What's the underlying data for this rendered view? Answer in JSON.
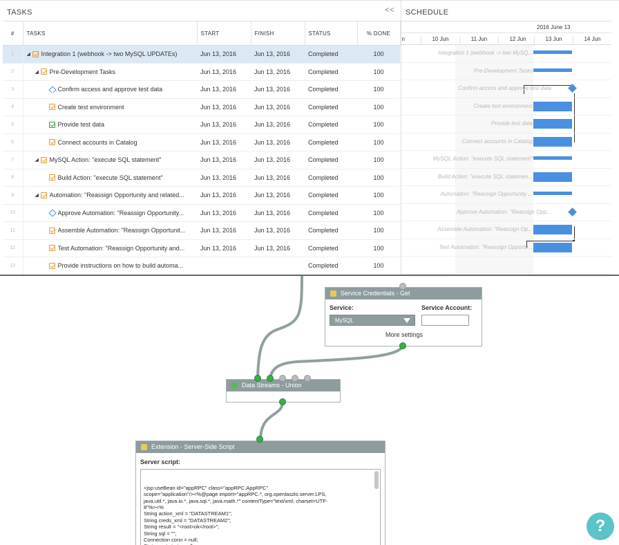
{
  "tasks_pane": {
    "title": "TASKS",
    "collapse_glyph": "<<",
    "columns": {
      "num": "#",
      "tasks": "TASKS",
      "start": "START",
      "finish": "FINISH",
      "status": "STATUS",
      "pct": "% DONE"
    },
    "rows": [
      {
        "num": "1",
        "indent": 0,
        "caret": "◢",
        "icon": "task-check",
        "name": "Integration 1 (webhook -> two MySQL UPDATEs)",
        "start": "Jun 13, 2016",
        "finish": "Jun 13, 2016",
        "status": "Completed",
        "pct": "100",
        "selected": true
      },
      {
        "num": "2",
        "indent": 1,
        "caret": "◢",
        "icon": "task-check",
        "name": "Pre-Development Tasks",
        "start": "Jun 13, 2016",
        "finish": "Jun 13, 2016",
        "status": "Completed",
        "pct": "100"
      },
      {
        "num": "3",
        "indent": 2,
        "caret": "",
        "icon": "milestone",
        "name": "Confirm access and approve test data",
        "start": "Jun 13, 2016",
        "finish": "Jun 13, 2016",
        "status": "Completed",
        "pct": "100"
      },
      {
        "num": "4",
        "indent": 2,
        "caret": "",
        "icon": "task-check",
        "name": "Create test environment",
        "start": "Jun 13, 2016",
        "finish": "Jun 13, 2016",
        "status": "Completed",
        "pct": "100"
      },
      {
        "num": "5",
        "indent": 2,
        "caret": "",
        "icon": "task-plus",
        "name": "Provide test data",
        "start": "Jun 13, 2016",
        "finish": "Jun 13, 2016",
        "status": "Completed",
        "pct": "100"
      },
      {
        "num": "6",
        "indent": 2,
        "caret": "",
        "icon": "task-check",
        "name": "Connect accounts in Catalog",
        "start": "Jun 13, 2016",
        "finish": "Jun 13, 2016",
        "status": "Completed",
        "pct": "100"
      },
      {
        "num": "7",
        "indent": 1,
        "caret": "◢",
        "icon": "task-check",
        "name": "MySQL Action: \"execute SQL statement\"",
        "start": "Jun 13, 2016",
        "finish": "Jun 13, 2016",
        "status": "Completed",
        "pct": "100"
      },
      {
        "num": "8",
        "indent": 2,
        "caret": "",
        "icon": "task-check",
        "name": "Build Action: \"execute SQL statement\"",
        "start": "Jun 13, 2016",
        "finish": "Jun 13, 2016",
        "status": "Completed",
        "pct": "100"
      },
      {
        "num": "9",
        "indent": 1,
        "caret": "◢",
        "icon": "task-check",
        "name": "Automation: \"Reassign Opportunity and related...",
        "start": "Jun 13, 2016",
        "finish": "Jun 13, 2016",
        "status": "Completed",
        "pct": "100"
      },
      {
        "num": "10",
        "indent": 2,
        "caret": "",
        "icon": "milestone",
        "name": "Approve Automation: \"Reassign Opportunity...",
        "start": "Jun 13, 2016",
        "finish": "Jun 13, 2016",
        "status": "Completed",
        "pct": "100"
      },
      {
        "num": "11",
        "indent": 2,
        "caret": "",
        "icon": "task-check",
        "name": "Assemble Automation: \"Reassign Opportunit...",
        "start": "Jun 13, 2016",
        "finish": "Jun 13, 2016",
        "status": "Completed",
        "pct": "100"
      },
      {
        "num": "12",
        "indent": 2,
        "caret": "",
        "icon": "task-check",
        "name": "Test Automation: \"Reassign Opportunity and...",
        "start": "Jun 13, 2016",
        "finish": "Jun 13, 2016",
        "status": "Completed",
        "pct": "100"
      },
      {
        "num": "13",
        "indent": 2,
        "caret": "",
        "icon": "task-check",
        "name": "Provide instructions on how to build automa...",
        "start": "",
        "finish": "",
        "status": "Completed",
        "pct": "100"
      }
    ]
  },
  "schedule_pane": {
    "title": "SCHEDULE",
    "top_label": "2016 June 13",
    "days": [
      "un",
      "10 Jun",
      "11 Jun",
      "12 Jun",
      "13 Jun",
      "14 Jun"
    ],
    "labels": [
      "Integration 1 (webhook -> two MySQ...",
      "Pre-Development Tasks",
      "Confirm access and approve test data",
      "Create test environment",
      "Provide test data",
      "Connect accounts in Catalog",
      "MySQL Action: \"execute SQL statement\"",
      "Build Action: \"execute SQL statemen...",
      "Automation: \"Reassign Opportunity ...",
      "Approve Automation: \"Reassign Opp...",
      "Assemble Automation: \"Reassign Op...",
      "Test Automation: \"Reassign Opportu...",
      ""
    ]
  },
  "workflow": {
    "service_credentials": {
      "title": "Service Credentials - Get",
      "service_label": "Service:",
      "service_value": "MySQL",
      "account_label": "Service Account:",
      "account_value": "",
      "more_settings": "More settings"
    },
    "union_node": {
      "title": "Data Streams - Union"
    },
    "script_node": {
      "title": "Extension - Server-Side Script",
      "script_label": "Server script:",
      "script_text": "<jsp:useBean id=\"appRPC\" class=\"appRPC.AppRPC\"\nscope=\"application\"/><%@page import=\"appRPC.*, org.openlaszlo.server.LPS,\njava.util.*, java.io.*, java.sql.*, java.math.*\" contentType=\"text/xml; charset=UTF-\n8\"%><%\nString action_xml = \"DATASTREAM1\";\nString creds_xml = \"DATASTREAM2\";\nString result = \"<root>ok</root>\";\nString sql = \"\";\nConnection conn = null;\nStatement stmt = null;\n\n..."
    }
  },
  "help_button": {
    "label": "?"
  },
  "colors": {
    "bar": "#4a90e2",
    "port": "#36b14a",
    "node_header": "#8e9c9e",
    "selected_row": "#dde8f5",
    "help": "#5cc4c9"
  }
}
